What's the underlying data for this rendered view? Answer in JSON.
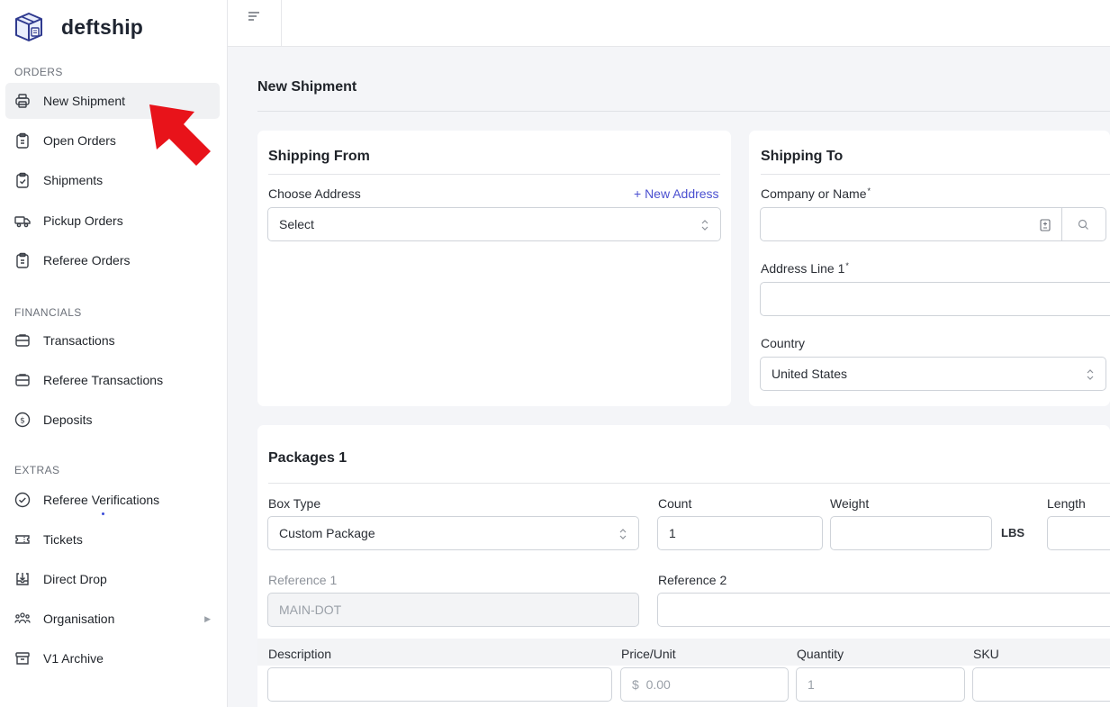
{
  "brand": {
    "name": "deftship"
  },
  "sidebar": {
    "sections": {
      "orders": "ORDERS",
      "financials": "FINANCIALS",
      "extras": "EXTRAS"
    },
    "items": [
      {
        "label": "New Shipment",
        "icon": "printer-icon"
      },
      {
        "label": "Open Orders",
        "icon": "clipboard-icon"
      },
      {
        "label": "Shipments",
        "icon": "clipboard-check-icon"
      },
      {
        "label": "Pickup Orders",
        "icon": "truck-icon"
      },
      {
        "label": "Referee Orders",
        "icon": "clipboard-icon"
      },
      {
        "label": "Transactions",
        "icon": "wallet-icon"
      },
      {
        "label": "Referee Transactions",
        "icon": "wallet-icon"
      },
      {
        "label": "Deposits",
        "icon": "dollar-circle-icon"
      },
      {
        "label": "Referee Verifications",
        "icon": "check-circle-icon"
      },
      {
        "label": "Tickets",
        "icon": "ticket-icon"
      },
      {
        "label": "Direct Drop",
        "icon": "inbox-download-icon"
      },
      {
        "label": "Organisation",
        "icon": "users-icon",
        "chevron": "▶"
      },
      {
        "label": "V1 Archive",
        "icon": "archive-icon"
      }
    ],
    "active_item": "New Shipment"
  },
  "main": {
    "title": "New Shipment",
    "shipping_from": {
      "title": "Shipping From",
      "choose_address_label": "Choose Address",
      "new_address_link": "+ New Address",
      "select_value": "Select"
    },
    "shipping_to": {
      "title": "Shipping To",
      "company_label": "Company or Name",
      "address_label": "Address Line 1",
      "required_mark": "*",
      "country_label": "Country",
      "country_value": "United States"
    },
    "packages": {
      "title": "Packages 1",
      "box_type_label": "Box Type",
      "box_type_value": "Custom Package",
      "count_label": "Count",
      "count_value": "1",
      "weight_label": "Weight",
      "weight_unit": "LBS",
      "length_label": "Length",
      "reference1_label": "Reference 1",
      "reference1_value": "MAIN-DOT",
      "reference2_label": "Reference 2",
      "description_label": "Description",
      "price_label": "Price/Unit",
      "price_placeholder": "$  0.00",
      "quantity_label": "Quantity",
      "quantity_placeholder": "1",
      "sku_label": "SKU"
    }
  },
  "colors": {
    "accent": "#4a4fd0",
    "annotation_arrow": "#e8131a",
    "background": "#f4f5f8"
  }
}
